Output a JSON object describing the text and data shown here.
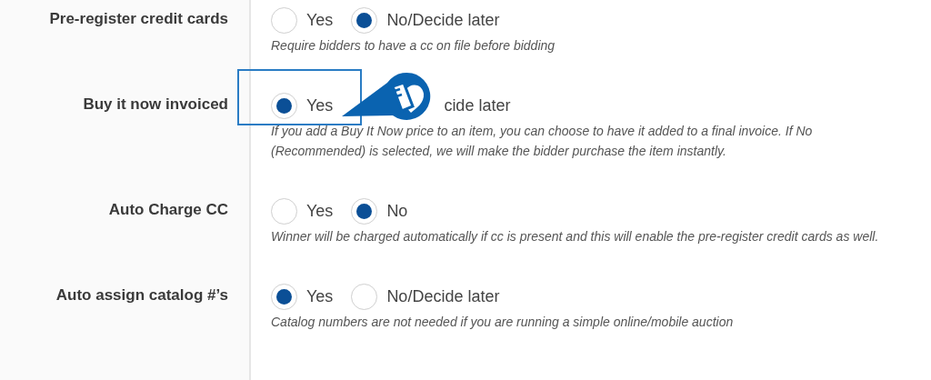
{
  "settings": [
    {
      "label": "Pre-register credit cards",
      "options": [
        {
          "label": "Yes",
          "selected": false,
          "kind": "radio"
        },
        {
          "label": "No/Decide later",
          "selected": true,
          "kind": "radio"
        }
      ],
      "description": "Require bidders to have a cc on file before bidding"
    },
    {
      "label": "Buy it now invoiced",
      "options": [
        {
          "label": "Yes",
          "selected": true,
          "kind": "radio"
        },
        {
          "label": "cide later",
          "kind": "covered"
        }
      ],
      "description": "If you add a Buy It Now price to an item, you can choose to have it added to a final invoice. If No (Recommended) is selected, we will make the bidder purchase the item instantly.",
      "highlighted": true
    },
    {
      "label": "Auto Charge CC",
      "options": [
        {
          "label": "Yes",
          "selected": false,
          "kind": "radio"
        },
        {
          "label": "No",
          "selected": true,
          "kind": "radio"
        }
      ],
      "description": "Winner will be charged automatically if cc is present and this will enable the pre-register credit cards as well."
    },
    {
      "label": "Auto assign catalog #’s",
      "options": [
        {
          "label": "Yes",
          "selected": true,
          "kind": "radio"
        },
        {
          "label": "No/Decide later",
          "selected": false,
          "kind": "radio"
        }
      ],
      "description": "Catalog numbers are not needed if you are running a simple online/mobile auction"
    }
  ]
}
